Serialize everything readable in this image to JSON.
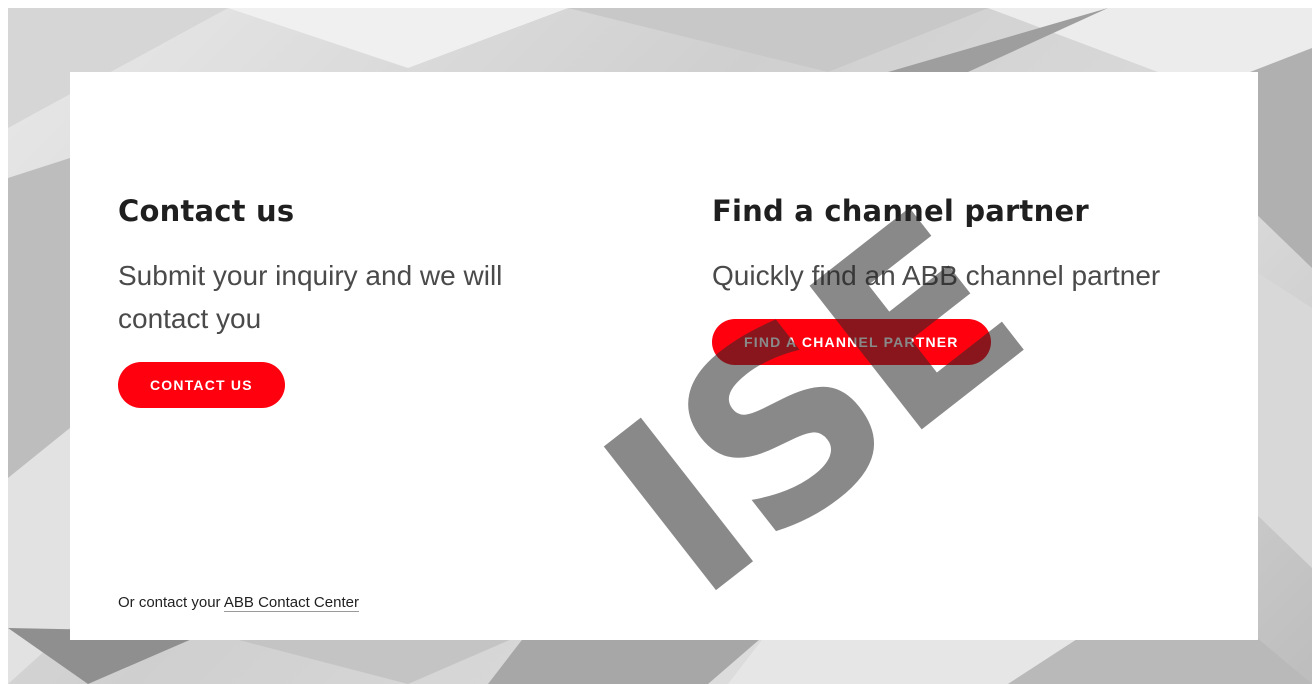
{
  "contact": {
    "heading": "Contact us",
    "description": "Submit your inquiry and we will contact you",
    "button_label": "CONTACT US"
  },
  "partner": {
    "heading": "Find a channel partner",
    "description": "Quickly find an ABB channel partner",
    "button_label": "FIND A CHANNEL PARTNER"
  },
  "footer": {
    "prefix": "Or contact your ",
    "link_label": "ABB Contact Center"
  },
  "watermark": {
    "text": "ISE"
  },
  "colors": {
    "accent": "#ff000f",
    "heading_text": "#1f1f1f",
    "body_text": "#4a4a4a",
    "card_background": "#ffffff"
  }
}
